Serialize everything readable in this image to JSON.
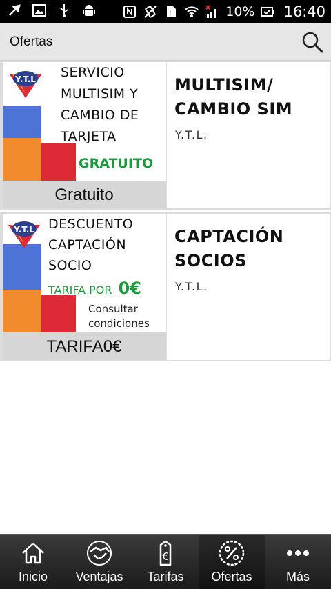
{
  "status_bar": {
    "battery_text": "10%",
    "time": "16:40"
  },
  "header": {
    "title": "Ofertas"
  },
  "offers": [
    {
      "banner_lines": [
        "SERVICIO",
        "MULTISIM Y",
        "CAMBIO DE",
        "TARJETA"
      ],
      "banner_highlight": "GRATUITO",
      "price_label": "Gratuito",
      "title_lines": [
        "MULTISIM/",
        "CAMBIO SIM"
      ],
      "company": "Y.T.L."
    },
    {
      "banner_lines": [
        "DESCUENTO",
        "CAPTACIÓN",
        "SOCIO"
      ],
      "banner_highlight_prefix": "TARIFA POR",
      "banner_highlight_value": "0€",
      "banner_note_lines": [
        "Consultar",
        "condiciones"
      ],
      "price_label": "TARIFA0€",
      "title_lines": [
        "CAPTACIÓN",
        "SOCIOS"
      ],
      "company": "Y.T.L."
    }
  ],
  "logo_text": "Y.T.L",
  "bottom_nav": {
    "items": [
      {
        "label": "Inicio",
        "icon": "home-icon"
      },
      {
        "label": "Ventajas",
        "icon": "handshake-icon"
      },
      {
        "label": "Tarifas",
        "icon": "euro-tag-icon"
      },
      {
        "label": "Ofertas",
        "icon": "percent-badge-icon"
      },
      {
        "label": "Más",
        "icon": "more-dots-icon"
      }
    ],
    "active": "Ofertas"
  },
  "colors": {
    "accent_green": "#1a9a3a",
    "block_blue": "#4e73d6",
    "block_orange": "#f28a2e",
    "block_red": "#dd2a36",
    "header_bg": "#e6e6e6",
    "nav_bg": "#2a2a2a"
  }
}
